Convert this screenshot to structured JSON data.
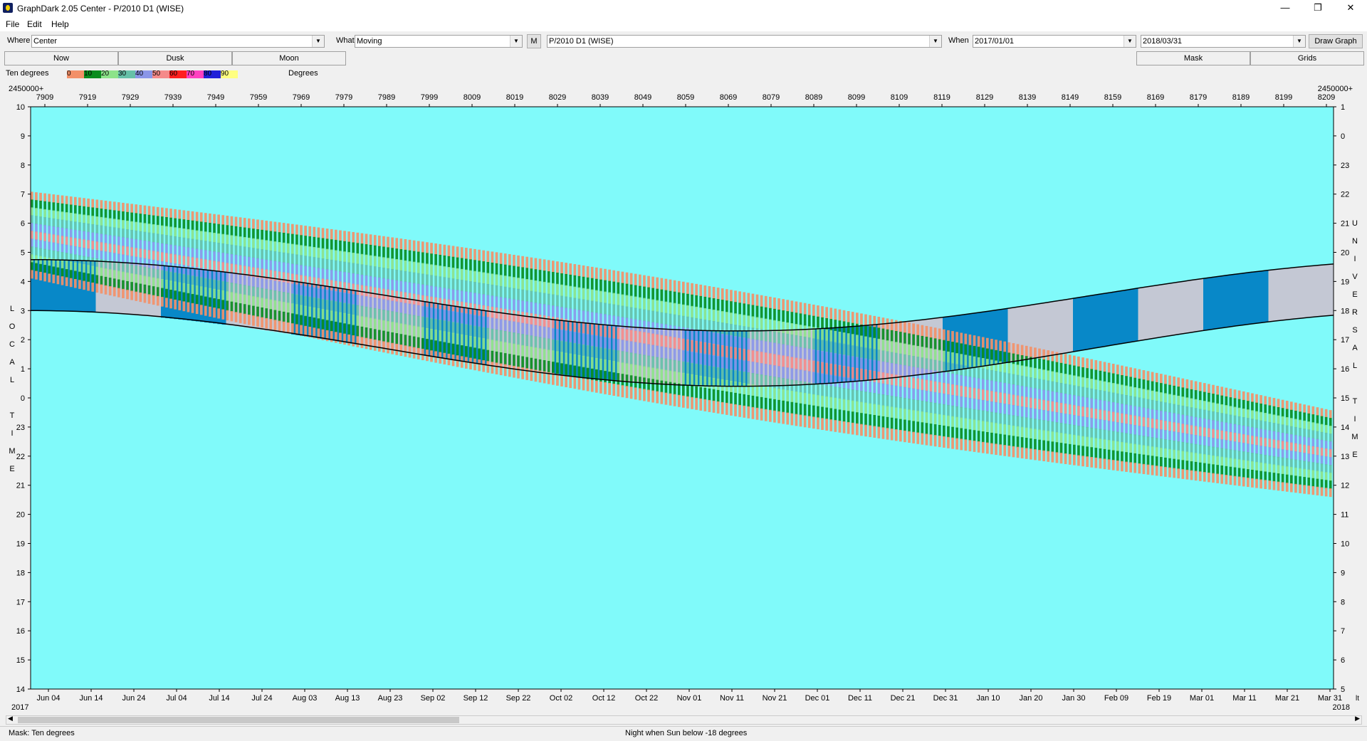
{
  "window": {
    "title": "GraphDark 2.05  Center  -  P/2010 D1 (WISE)",
    "minimize": "—",
    "restore": "❐",
    "close": "✕"
  },
  "menu": [
    "File",
    "Edit",
    "Help"
  ],
  "toolbar": {
    "where_label": "Where",
    "where_value": "Center",
    "what_label": "What",
    "what_value": "Moving",
    "m_button": "M",
    "object_value": "P/2010 D1 (WISE)",
    "when_label": "When",
    "when_start": "2017/01/01",
    "when_end": "2018/03/31",
    "draw_button": "Draw Graph"
  },
  "tabs": [
    "Now",
    "Dusk",
    "Moon",
    "Mask",
    "Grids"
  ],
  "legend": {
    "title": "Ten degrees",
    "units": "Degrees",
    "items": [
      {
        "label": "0",
        "color": "#f39068"
      },
      {
        "label": "10",
        "color": "#0a8c1e"
      },
      {
        "label": "20",
        "color": "#8de38a"
      },
      {
        "label": "30",
        "color": "#66c0a8"
      },
      {
        "label": "40",
        "color": "#8a96e8"
      },
      {
        "label": "50",
        "color": "#f58a8a"
      },
      {
        "label": "60",
        "color": "#ff2020"
      },
      {
        "label": "70",
        "color": "#ff40c0"
      },
      {
        "label": "80",
        "color": "#2020d8"
      },
      {
        "label": "90",
        "color": "#ffff80"
      }
    ]
  },
  "chart_data": {
    "type": "heatmap",
    "jd_prefix_left": "2450000+",
    "jd_prefix_right": "2450000+",
    "top_ticks": [
      "7909",
      "7919",
      "7929",
      "7939",
      "7949",
      "7959",
      "7969",
      "7979",
      "7989",
      "7999",
      "8009",
      "8019",
      "8029",
      "8039",
      "8049",
      "8059",
      "8069",
      "8079",
      "8089",
      "8099",
      "8109",
      "8119",
      "8129",
      "8139",
      "8149",
      "8159",
      "8169",
      "8179",
      "8189",
      "8199",
      "8209"
    ],
    "bottom_ticks": [
      "Jun 04",
      "Jun 14",
      "Jun 24",
      "Jul 04",
      "Jul 14",
      "Jul 24",
      "Aug 03",
      "Aug 13",
      "Aug 23",
      "Sep 02",
      "Sep 12",
      "Sep 22",
      "Oct 02",
      "Oct 12",
      "Oct 22",
      "Nov 01",
      "Nov 11",
      "Nov 21",
      "Dec 01",
      "Dec 11",
      "Dec 21",
      "Dec 31",
      "Jan 10",
      "Jan 20",
      "Jan 30",
      "Feb 09",
      "Feb 19",
      "Mar 01",
      "Mar 11",
      "Mar 21",
      "Mar 31"
    ],
    "year_left": "2017",
    "year_right": "2018",
    "right_corner": "lt",
    "left_ticks": [
      "10",
      "9",
      "8",
      "7",
      "6",
      "5",
      "4",
      "3",
      "2",
      "1",
      "0",
      "23",
      "22",
      "21",
      "20",
      "19",
      "18",
      "17",
      "16",
      "15",
      "14"
    ],
    "right_ticks": [
      "1",
      "0",
      "23",
      "22",
      "21",
      "20",
      "19",
      "18",
      "17",
      "16",
      "15",
      "14",
      "13",
      "12",
      "11",
      "10",
      "9",
      "8",
      "7",
      "6",
      "5"
    ],
    "left_axis_label": "LOCAL TIME",
    "right_axis_label": "UNIVERSAL TIME",
    "colors": {
      "day": "#80fafa",
      "twilight": "#0888c8",
      "night": "#080840",
      "moon": "#c4c8d4"
    }
  },
  "status": {
    "mask": "Mask:  Ten degrees",
    "night": "Night when Sun below -18 degrees"
  }
}
